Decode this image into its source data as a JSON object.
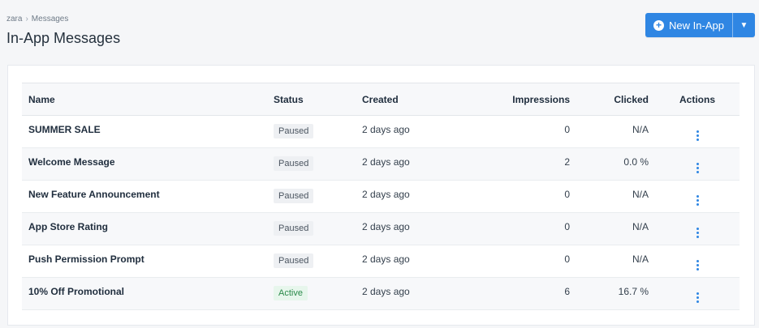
{
  "breadcrumb": {
    "root": "zara",
    "separator": "›",
    "current": "Messages"
  },
  "page": {
    "title": "In-App Messages"
  },
  "new_button": {
    "label": "New In-App",
    "icon": "plus-circle-icon",
    "caret": "▼"
  },
  "table": {
    "columns": [
      "Name",
      "Status",
      "Created",
      "Impressions",
      "Clicked",
      "Actions"
    ],
    "rows": [
      {
        "name": "SUMMER SALE",
        "status": "Paused",
        "created": "2 days ago",
        "impressions": "0",
        "clicked": "N/A"
      },
      {
        "name": "Welcome Message",
        "status": "Paused",
        "created": "2 days ago",
        "impressions": "2",
        "clicked": "0.0 %"
      },
      {
        "name": "New Feature Announcement",
        "status": "Paused",
        "created": "2 days ago",
        "impressions": "0",
        "clicked": "N/A"
      },
      {
        "name": "App Store Rating",
        "status": "Paused",
        "created": "2 days ago",
        "impressions": "0",
        "clicked": "N/A"
      },
      {
        "name": "Push Permission Prompt",
        "status": "Paused",
        "created": "2 days ago",
        "impressions": "0",
        "clicked": "N/A"
      },
      {
        "name": "10% Off Promotional",
        "status": "Active",
        "created": "2 days ago",
        "impressions": "6",
        "clicked": "16.7 %"
      }
    ]
  },
  "colors": {
    "accent": "#2f86e3",
    "active": "#2a8a4a",
    "paused_bg": "#eef0f3"
  }
}
